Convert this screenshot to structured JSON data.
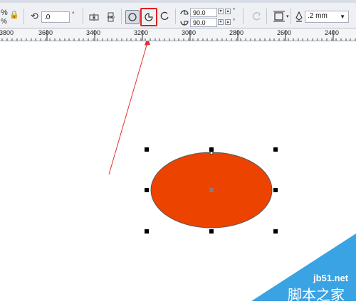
{
  "toolbar": {
    "rotation_value": ".0",
    "rotation_unit": "°",
    "start_angle": "90.0",
    "end_angle": "90.0",
    "angle_unit": "°",
    "outline_width": ".2 mm"
  },
  "ruler": {
    "labels": [
      "3800",
      "3600",
      "3400",
      "3200",
      "3000",
      "2800",
      "2600",
      "2400"
    ]
  },
  "canvas": {
    "ellipse_fill": "#ec4300",
    "ellipse_outline": "#5a5a5a",
    "arrow_color": "#e33030",
    "highlight_color": "#e02020"
  },
  "watermark": {
    "site": "jb51.net",
    "name": "脚本之家",
    "color": "#3aa3e3"
  }
}
